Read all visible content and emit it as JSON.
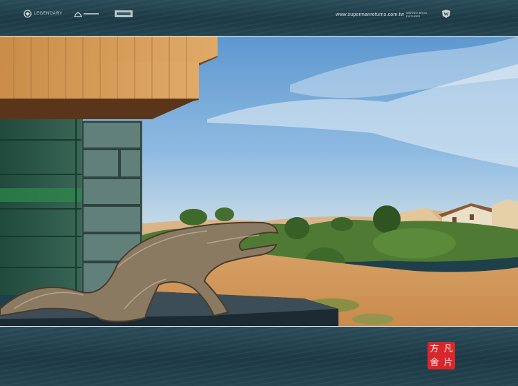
{
  "header": {
    "logo_left_text": "LEGENDARY",
    "website": "www.supermanreturns.com.tw",
    "studio_credit": "WARNER BROS. PICTURES"
  },
  "seal": {
    "chars": [
      "方",
      "凡",
      "舍",
      "片"
    ],
    "color": "#d8262a"
  },
  "photo": {
    "subject": "desert-architecture-with-driftwood",
    "icon": "photo-icon"
  },
  "colors": {
    "band": "#1f3f4a",
    "sky": "#6fa6d6",
    "sand": "#d9a36a"
  }
}
